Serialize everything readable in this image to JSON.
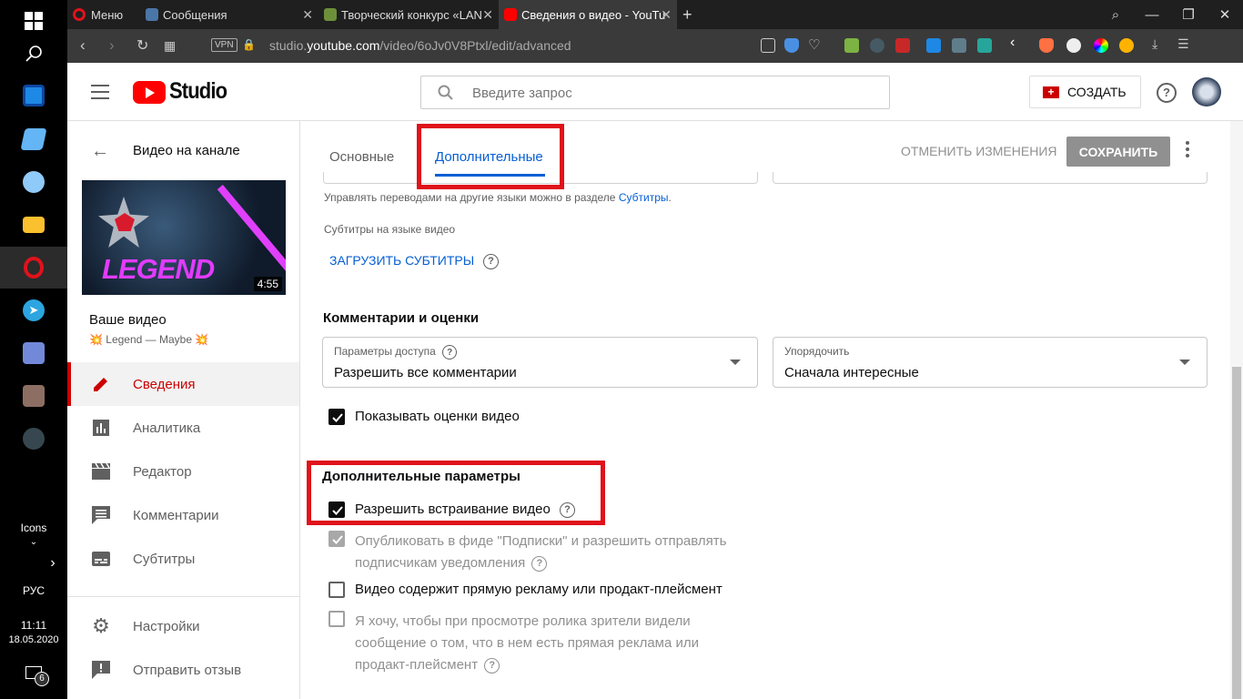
{
  "taskbar": {
    "icons_label": "Icons",
    "lang": "РУС",
    "time": "11:11",
    "date": "18.05.2020",
    "notif_count": "6"
  },
  "browser": {
    "menu_label": "Меню",
    "tabs": [
      {
        "title": "Сообщения"
      },
      {
        "title": "Творческий конкурс «LAN"
      },
      {
        "title": "Сведения о видео - YouTu"
      }
    ],
    "vpn": "VPN",
    "url_prefix": "studio.",
    "url_host": "youtube.com",
    "url_path": "/video/6oJv0V8Ptxl/edit/advanced"
  },
  "header": {
    "logo_text": "Studio",
    "search_placeholder": "Введите запрос",
    "create_label": "СОЗДАТЬ",
    "help": "?"
  },
  "sidebar": {
    "back_title": "Видео на канале",
    "thumb_text": "LEGEND",
    "duration": "4:55",
    "your_video": "Ваше видео",
    "video_title": "💥 Legend — Maybe 💥",
    "items": [
      {
        "label": "Сведения"
      },
      {
        "label": "Аналитика"
      },
      {
        "label": "Редактор"
      },
      {
        "label": "Комментарии"
      },
      {
        "label": "Субтитры"
      },
      {
        "label": "Настройки"
      },
      {
        "label": "Отправить отзыв"
      }
    ]
  },
  "tabs": {
    "basic": "Основные",
    "advanced": "Дополнительные",
    "cancel": "ОТМЕНИТЬ ИЗМЕНЕНИЯ",
    "save": "СОХРАНИТЬ"
  },
  "content": {
    "translations_text": "Управлять переводами на другие языки можно в разделе",
    "translations_link": "Субтитры",
    "translations_end": ".",
    "subs_lang_label": "Субтитры на языке видео",
    "upload_subs": "ЗАГРУЗИТЬ СУБТИТРЫ",
    "comments_heading": "Комментарии и оценки",
    "access": {
      "label": "Параметры доступа",
      "value": "Разрешить все комментарии"
    },
    "sort": {
      "label": "Упорядочить",
      "value": "Сначала интересные"
    },
    "show_ratings": "Показывать оценки видео",
    "advanced_heading": "Дополнительные параметры",
    "allow_embed": "Разрешить встраивание видео",
    "publish_feed_1": "Опубликовать в фиде \"Подписки\" и разрешить отправлять",
    "publish_feed_2": "подписчикам уведомления",
    "paid_promo": "Видео содержит прямую рекламу или продакт-плейсмент",
    "viewers_1": "Я хочу, чтобы при просмотре ролика зрители видели",
    "viewers_2": "сообщение о том, что в нем есть прямая реклама или",
    "viewers_3": "продакт-плейсмент"
  },
  "colors": {
    "accent": "#065fd4",
    "red": "#cc0000",
    "highlight": "#e0121b"
  }
}
